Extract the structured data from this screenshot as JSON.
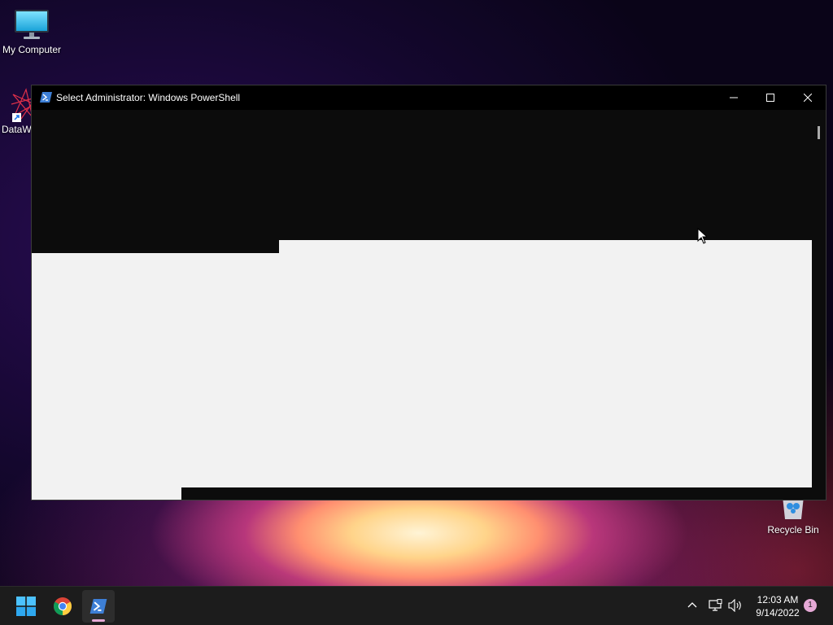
{
  "desktop": {
    "icons": [
      {
        "label": "My Computer",
        "icon": "monitor-icon"
      },
      {
        "label": "DataW",
        "icon": "datawrapper-shortcut-icon"
      },
      {
        "label": "Recycle Bin",
        "icon": "recycle-bin-icon"
      }
    ]
  },
  "window": {
    "title": "Select Administrator: Windows PowerShell",
    "icon": "powershell-icon",
    "controls": {
      "minimize": "minimize-icon",
      "maximize": "maximize-icon",
      "close": "close-icon"
    }
  },
  "taskbar": {
    "apps": [
      {
        "name": "Start",
        "icon": "windows-start-icon"
      },
      {
        "name": "Google Chrome",
        "icon": "chrome-icon"
      },
      {
        "name": "Windows PowerShell",
        "icon": "powershell-icon",
        "active": true
      }
    ],
    "tray": {
      "icons": [
        "chevron-up-icon",
        "network-icon",
        "volume-icon"
      ],
      "time": "12:03 AM",
      "date": "9/14/2022",
      "notification_count": "1"
    }
  },
  "colors": {
    "console_bg": "#0c0c0c",
    "selection_bg": "#f2f2f2",
    "taskbar_bg": "#1c1c1c",
    "accent": "#e6a9d6"
  }
}
